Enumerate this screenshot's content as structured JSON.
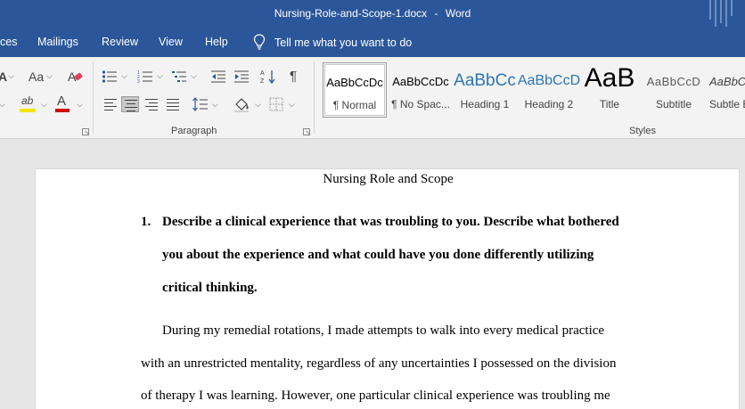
{
  "titlebar": {
    "filename": "Nursing-Role-and-Scope-1.docx",
    "separator": "-",
    "app_name": "Word"
  },
  "tabs": [
    {
      "label": "ces"
    },
    {
      "label": "Mailings"
    },
    {
      "label": "Review"
    },
    {
      "label": "View"
    },
    {
      "label": "Help"
    }
  ],
  "tell_me": "Tell me what you want to do",
  "ribbon": {
    "font_group": {
      "change_case_label": "Aa",
      "highlight_label": "ab",
      "font_color_label": "A",
      "highlight_color": "#f2e600",
      "font_color": "#d00000",
      "clear_formatting_color": "#e04060"
    },
    "paragraph_group": {
      "label": "Paragraph"
    },
    "styles_group": {
      "label": "Styles",
      "items": [
        {
          "sample": "AaBbCcDc",
          "name": "¶ Normal",
          "selected": true
        },
        {
          "sample": "AaBbCcDc",
          "name": "¶ No Spac...",
          "selected": false
        },
        {
          "sample": "AaBbCc",
          "name": "Heading 1",
          "selected": false
        },
        {
          "sample": "AaBbCcD",
          "name": "Heading 2",
          "selected": false
        },
        {
          "sample": "AaB",
          "name": "Title",
          "selected": false
        },
        {
          "sample": "AaBbCcD",
          "name": "Subtitle",
          "selected": false
        },
        {
          "sample": "AaBbCcD",
          "name": "Subtle E",
          "selected": false
        }
      ]
    }
  },
  "document": {
    "title": "Nursing Role and Scope",
    "question_number": "1.",
    "question_lines": [
      "Describe a clinical experience that was troubling to you. Describe what bothered",
      "you about the experience and what could have you done differently utilizing",
      "critical thinking."
    ],
    "paragraph_lines": [
      "During my remedial rotations, I made attempts to walk into every medical practice",
      "with an unrestricted mentality, regardless of any uncertainties I possessed on the division",
      "of therapy I was learning. However, one particular clinical experience was troubling me"
    ]
  },
  "colors": {
    "word_blue": "#2b579a",
    "ribbon_bg": "#f3f3f3",
    "doc_bg": "#e6e6e6",
    "heading_blue": "#2e74b5"
  }
}
